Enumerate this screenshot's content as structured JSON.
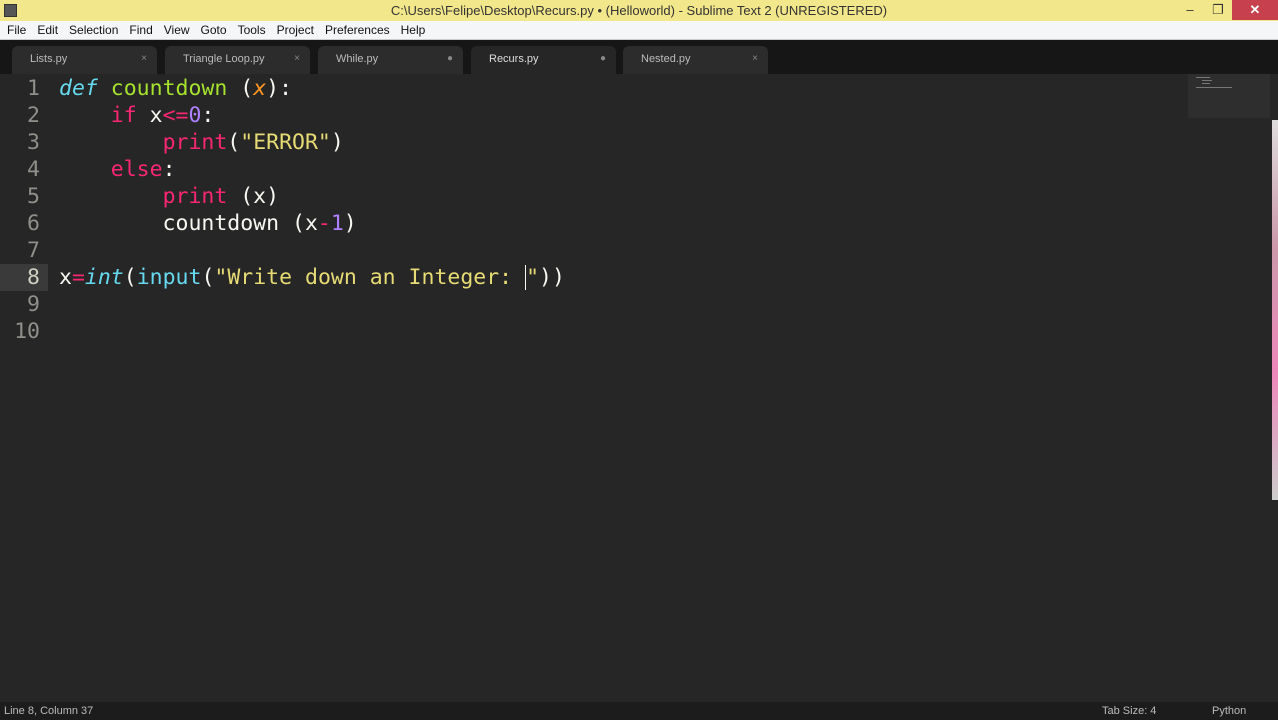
{
  "window": {
    "title": "C:\\Users\\Felipe\\Desktop\\Recurs.py • (Helloworld) - Sublime Text 2 (UNREGISTERED)",
    "minimize": "–",
    "restore": "❐",
    "close": "✕"
  },
  "menu": [
    "File",
    "Edit",
    "Selection",
    "Find",
    "View",
    "Goto",
    "Tools",
    "Project",
    "Preferences",
    "Help"
  ],
  "tabs": [
    {
      "label": "Lists.py",
      "state": "×",
      "active": false
    },
    {
      "label": "Triangle Loop.py",
      "state": "×",
      "active": false
    },
    {
      "label": "While.py",
      "state": "●",
      "active": false
    },
    {
      "label": "Recurs.py",
      "state": "●",
      "active": true
    },
    {
      "label": "Nested.py",
      "state": "×",
      "active": false
    }
  ],
  "editor": {
    "current_line": 8,
    "lines": [
      [
        [
          "def",
          "def"
        ],
        [
          " "
        ],
        [
          "countdown",
          "fn"
        ],
        [
          " ("
        ],
        [
          "x",
          "arg"
        ],
        [
          "):"
        ]
      ],
      [
        [
          "    "
        ],
        [
          "if",
          "kw"
        ],
        [
          " x"
        ],
        [
          "<=",
          "op"
        ],
        [
          "0",
          "num"
        ],
        [
          ":"
        ]
      ],
      [
        [
          "        "
        ],
        [
          "print",
          "kw"
        ],
        [
          "("
        ],
        [
          "\"ERROR\"",
          "str"
        ],
        [
          ")"
        ]
      ],
      [
        [
          "    "
        ],
        [
          "else",
          "kw"
        ],
        [
          ":"
        ]
      ],
      [
        [
          "        "
        ],
        [
          "print",
          "kw"
        ],
        [
          " (x)"
        ]
      ],
      [
        [
          "        countdown (x"
        ],
        [
          "-",
          "op"
        ],
        [
          "1",
          "num"
        ],
        [
          ")"
        ]
      ],
      [],
      [
        [
          "x"
        ],
        [
          "=",
          "op"
        ],
        [
          "int",
          "def"
        ],
        [
          "("
        ],
        [
          "input",
          "bi"
        ],
        [
          "("
        ],
        [
          "\"Write down an Integer: ",
          "str"
        ],
        [
          "\"",
          "str caret"
        ],
        [
          "))"
        ]
      ],
      [],
      []
    ]
  },
  "status": {
    "position": "Line 8, Column 37",
    "tab_size": "Tab Size: 4",
    "syntax": "Python"
  }
}
